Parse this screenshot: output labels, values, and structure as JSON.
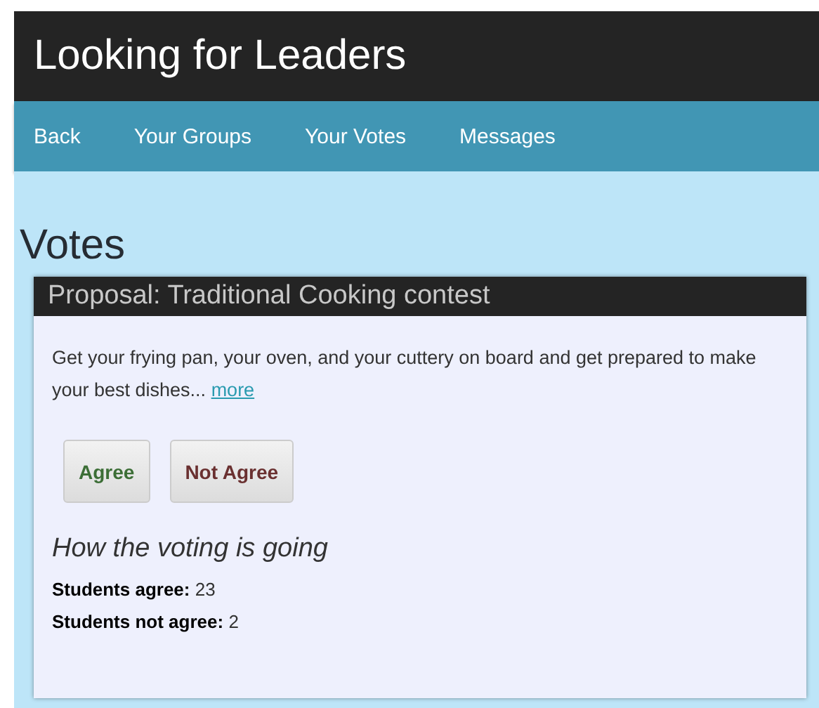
{
  "app_title": "Looking for Leaders",
  "nav": [
    {
      "label": "Back"
    },
    {
      "label": "Your Groups"
    },
    {
      "label": "Your Votes"
    },
    {
      "label": "Messages"
    }
  ],
  "page_title": "Votes",
  "proposal": {
    "title": "Proposal: Traditional Cooking contest",
    "description": "Get your frying pan, your oven, and your cuttery on board and get prepared to make your best dishes...",
    "more_link": "more",
    "buttons": [
      {
        "label": "Agree",
        "kind": "agree"
      },
      {
        "label": "Not Agree",
        "kind": "disagree"
      }
    ],
    "results_heading": "How the voting is going",
    "results": [
      "**Students agree:** 23",
      "**Students not agree:** 2"
    ]
  }
}
